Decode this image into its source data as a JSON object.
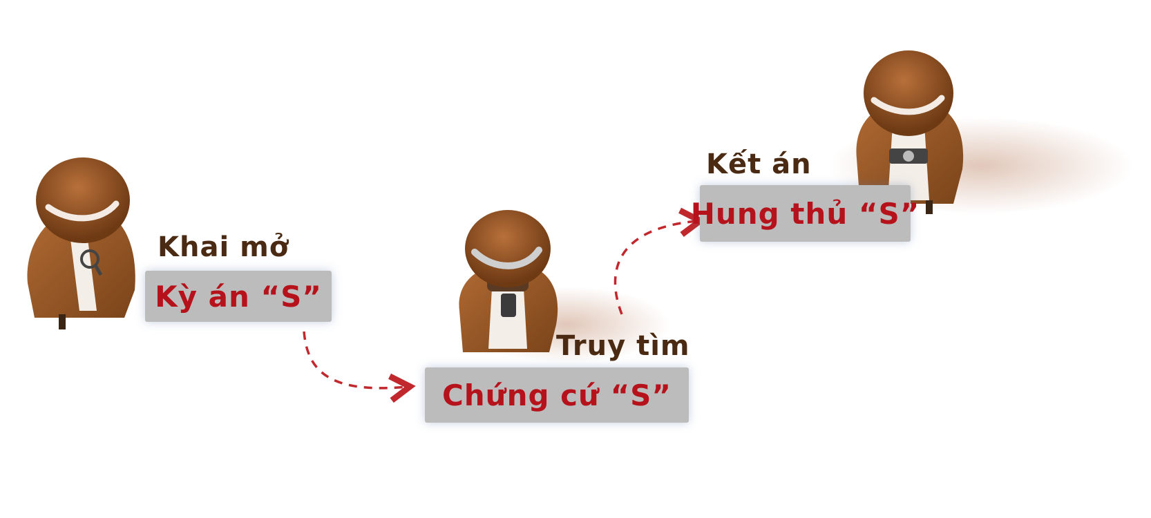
{
  "steps": [
    {
      "caption": "Khai mở",
      "plate": "Kỳ án “S”"
    },
    {
      "caption": "Truy tìm",
      "plate": "Chứng cứ “S”"
    },
    {
      "caption": "Kết án",
      "plate": "Hung thủ “S”"
    }
  ],
  "colors": {
    "caption": "#4a2a12",
    "plate_bg": "#bdbcbc",
    "plate_text": "#b5121b",
    "arrow": "#c0282d",
    "coat": "#9a5a2a",
    "hat": "#8a4a1e",
    "hat_band": "#f4ece4"
  },
  "icons": [
    "detective-magnifier-icon",
    "detective-phone-icon",
    "detective-camera-icon",
    "dashed-arrow-icon"
  ]
}
